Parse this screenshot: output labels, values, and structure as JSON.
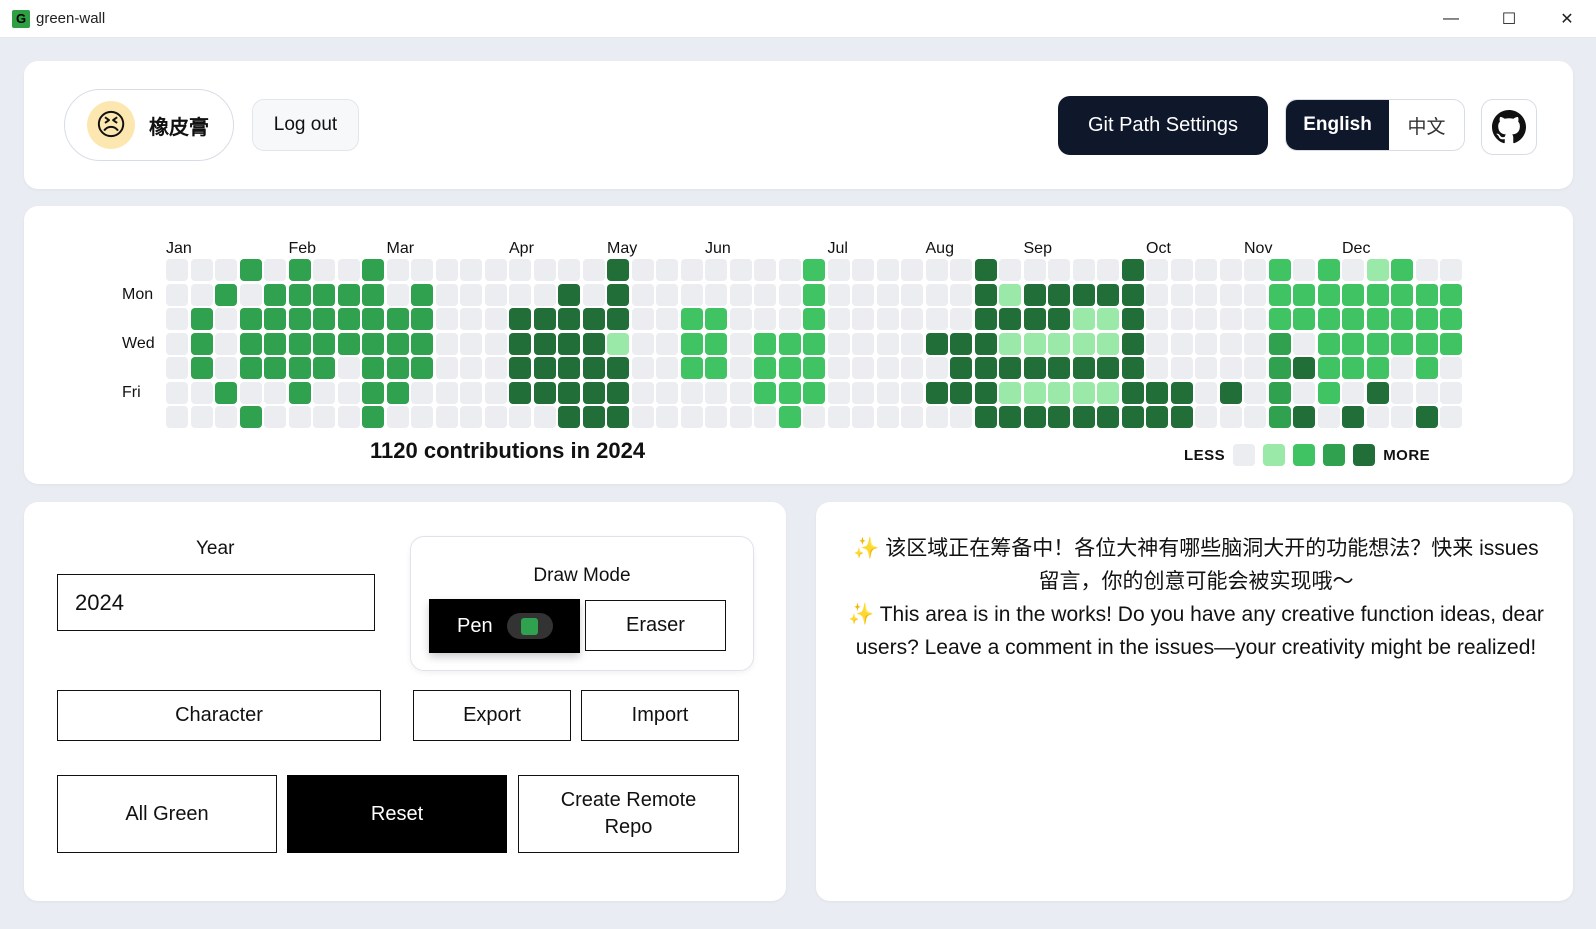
{
  "window": {
    "title": "green-wall",
    "app_icon_letter": "G"
  },
  "header": {
    "user_name": "橡皮膏",
    "logout_label": "Log out",
    "git_path_label": "Git Path Settings",
    "lang_en": "English",
    "lang_zh": "中文"
  },
  "graph": {
    "months": [
      "Jan",
      "Feb",
      "Mar",
      "Apr",
      "May",
      "Jun",
      "Jul",
      "Aug",
      "Sep",
      "Oct",
      "Nov",
      "Dec"
    ],
    "month_week_index": [
      0,
      5,
      9,
      14,
      18,
      22,
      27,
      31,
      35,
      40,
      44,
      48
    ],
    "day_labels": [
      {
        "row": 1,
        "label": "Mon"
      },
      {
        "row": 3,
        "label": "Wed"
      },
      {
        "row": 5,
        "label": "Fri"
      }
    ],
    "total_text": "1120 contributions in 2024",
    "legend_less": "LESS",
    "legend_more": "MORE",
    "colors": [
      "#ebedf0",
      "#9be9a8",
      "#40c463",
      "#30a14e",
      "#216e39"
    ],
    "weeks": [
      "0000000",
      "0033300",
      "0300030",
      "3033303",
      "0333300",
      "3333330",
      "0333300",
      "0333000",
      "3333333",
      "0033330",
      "0333300",
      "0000000",
      "0000000",
      "0000000",
      "0044440",
      "0044440",
      "0444444",
      "0044444",
      "4441444",
      "0000000",
      "0000000",
      "0022200",
      "0022200",
      "0000000",
      "0002220",
      "0002222",
      "2222220",
      "0000000",
      "0000000",
      "0000000",
      "0000000",
      "0004040",
      "0004440",
      "4444444",
      "0141414",
      "0441414",
      "0441414",
      "0411414",
      "0411414",
      "4444444",
      "0000044",
      "0000044",
      "0000000",
      "0000040",
      "0000000",
      "2223333",
      "0220404",
      "2222220",
      "0222204",
      "1222240",
      "2222000",
      "0222204",
      "0222000"
    ]
  },
  "controls": {
    "year_label": "Year",
    "year_value": "2024",
    "draw_mode_label": "Draw Mode",
    "pen_label": "Pen",
    "eraser_label": "Eraser",
    "character_label": "Character",
    "export_label": "Export",
    "import_label": "Import",
    "all_green_label": "All Green",
    "reset_label": "Reset",
    "create_remote_label": "Create Remote Repo"
  },
  "info": {
    "line_zh": "✨ 该区域正在筹备中！各位大神有哪些脑洞大开的功能想法？快来 issues 留言，你的创意可能会被实现哦～",
    "line_en": "✨ This area is in the works! Do you have any creative function ideas, dear users? Leave a comment in the issues—your creativity might be realized!"
  }
}
